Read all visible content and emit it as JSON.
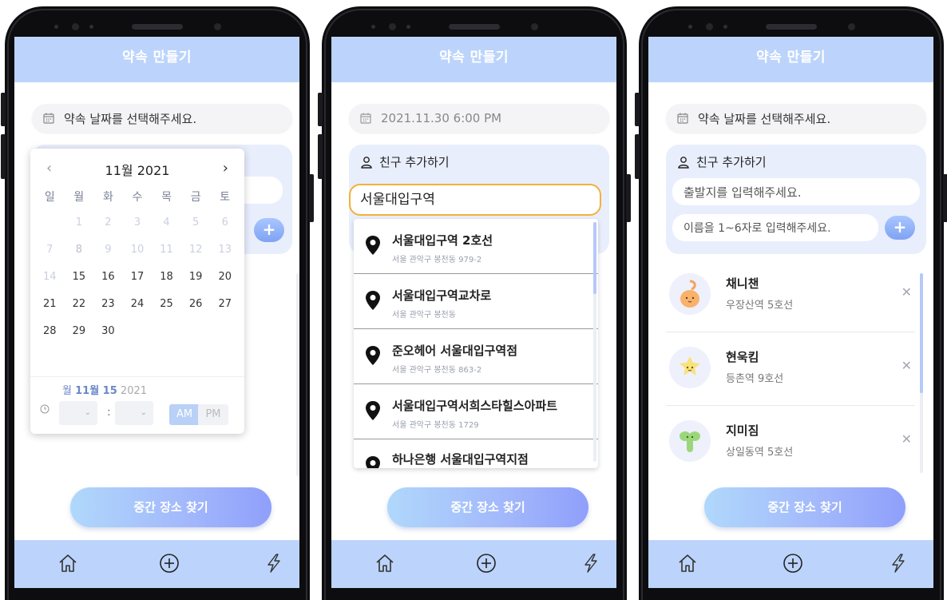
{
  "app": {
    "header_title": "약속 만들기",
    "cta_label": "중간 장소 찾기",
    "nav": [
      {
        "icon": "home-icon"
      },
      {
        "icon": "plus-circle-icon"
      },
      {
        "icon": "lightning-icon"
      }
    ]
  },
  "screen1": {
    "date_placeholder": "약속 날짜를 선택해주세요.",
    "calendar": {
      "prev": "‹",
      "next": "›",
      "month_year": "11월 2021",
      "weekdays": [
        "일",
        "월",
        "화",
        "수",
        "목",
        "금",
        "토"
      ],
      "rows": [
        [
          "",
          "1",
          "2",
          "3",
          "4",
          "5",
          "6"
        ],
        [
          "7",
          "8",
          "9",
          "10",
          "11",
          "12",
          "13"
        ],
        [
          "14",
          "15",
          "16",
          "17",
          "18",
          "19",
          "20"
        ],
        [
          "21",
          "22",
          "23",
          "24",
          "25",
          "26",
          "27"
        ],
        [
          "28",
          "29",
          "30",
          "",
          "",
          "",
          ""
        ]
      ],
      "selected_weekday": "월",
      "selected_date": "11월 15",
      "selected_year": "2021",
      "hour_value": "",
      "minute_value": "",
      "am": "AM",
      "pm": "PM"
    }
  },
  "screen2": {
    "date_value": "2021.11.30 6:00 PM",
    "friend_title": "친구 추가하기",
    "search_value": "서울대입구역",
    "results": [
      {
        "title": "서울대입구역 2호선",
        "sub": "서울 관악구 봉천동 979-2"
      },
      {
        "title": "서울대입구역교차로",
        "sub": "서울 관악구 봉천동"
      },
      {
        "title": "준오헤어 서울대입구역점",
        "sub": "서울 관악구 봉천동 863-2"
      },
      {
        "title": "서울대입구역서희스타힐스아파트",
        "sub": "서울 관악구 봉천동 1729"
      },
      {
        "title": "하나은행 서울대입구역지점",
        "sub": ""
      }
    ]
  },
  "screen3": {
    "date_placeholder": "약속 날짜를 선택해주세요.",
    "friend_title": "친구 추가하기",
    "start_placeholder": "출발지를 입력해주세요.",
    "name_placeholder": "이름을 1~6자로 입력해주세요.",
    "add_label": "+",
    "friends": [
      {
        "name": "채니챈",
        "station": "우장산역 5호선",
        "remove": "✕",
        "avatar_color": "#f8b26a"
      },
      {
        "name": "현욱킴",
        "station": "등촌역 9호선",
        "remove": "✕",
        "avatar_color": "#f8e27a"
      },
      {
        "name": "지미짐",
        "station": "상일동역 5호선",
        "remove": "✕",
        "avatar_color": "#9bd77a"
      }
    ]
  },
  "colors": {
    "header": "#bcd4fb",
    "accent": "#7fa3f3",
    "search_border": "#f2b13a"
  }
}
